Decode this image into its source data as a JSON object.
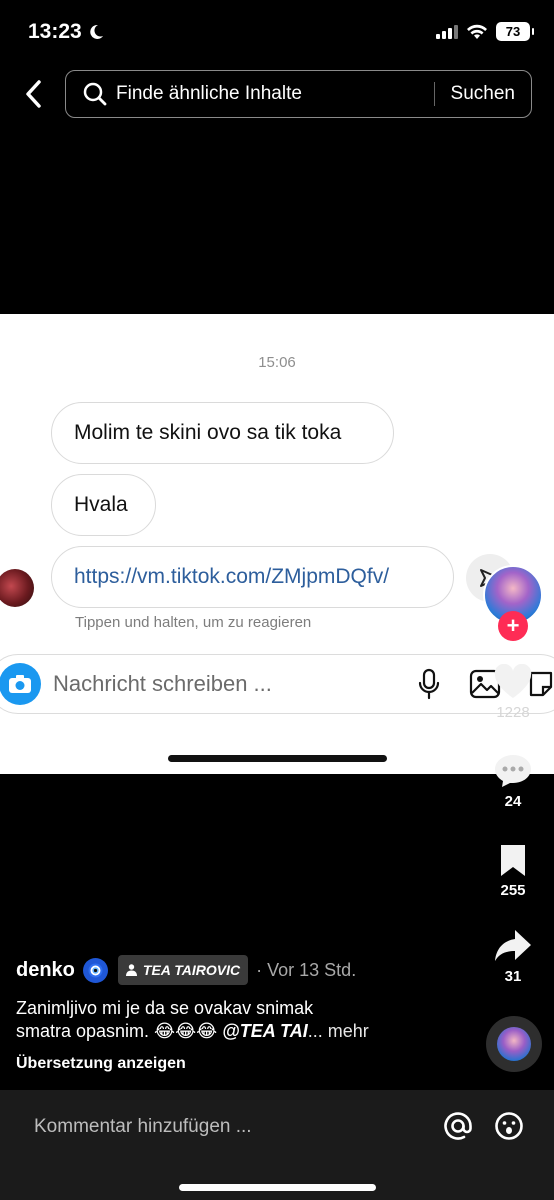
{
  "status_bar": {
    "time": "13:23",
    "battery": "73"
  },
  "search": {
    "placeholder": "Finde ähnliche Inhalte",
    "button": "Suchen"
  },
  "embedded_chat": {
    "timestamp": "15:06",
    "messages": [
      "Molim te skini ovo sa tik toka",
      "Hvala",
      "https://vm.tiktok.com/ZMjpmDQfv/"
    ],
    "hint": "Tippen und halten, um zu reagieren",
    "composer_placeholder": "Nachricht schreiben ..."
  },
  "rail": {
    "likes": "1228",
    "comments": "24",
    "saves": "255",
    "shares": "31"
  },
  "post": {
    "username": "denko",
    "tagged_user": "TEA TAIROVIC",
    "time_ago": "· Vor 13 Std.",
    "description_line1": "Zanimljivo mi je da se ovakav snimak",
    "description_line2": "smatra opasnim. 😂😂😂 ",
    "mention": "@TEA TAI",
    "more": "... mehr",
    "translate": "Übersetzung anzeigen"
  },
  "comment_bar": {
    "placeholder": "Kommentar hinzufügen ..."
  },
  "colors": {
    "follow": "#fe2c55",
    "link": "#2d5e9c",
    "camera": "#1a98f0"
  }
}
